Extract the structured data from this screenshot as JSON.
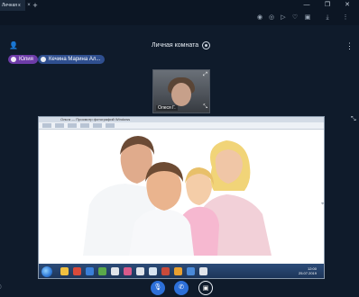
{
  "browser": {
    "tab_title": "Личная к",
    "tab_close": "×",
    "new_tab": "+",
    "minimize": "—",
    "maximize": "❐",
    "close": "✕"
  },
  "toolbar_icons": [
    "camera-icon",
    "target-icon",
    "send-icon",
    "heart-icon",
    "cube-icon",
    "download-icon",
    "menu-icon"
  ],
  "room": {
    "title": "Личная комната"
  },
  "participants": [
    {
      "name": "Юлия",
      "color": "#6d3ca8"
    },
    {
      "name": "Кечина Марина Ал...",
      "color": "#2f4f8f"
    }
  ],
  "thumbnail": {
    "label": "Олеся Г."
  },
  "shared_screen": {
    "window_title": "Ольга — Просмотр фотографий Windows",
    "clock_time": "12:00",
    "clock_date": "25.07.2019"
  },
  "colors": {
    "background": "#0f1b2b",
    "accent": "#2c6fd8"
  }
}
